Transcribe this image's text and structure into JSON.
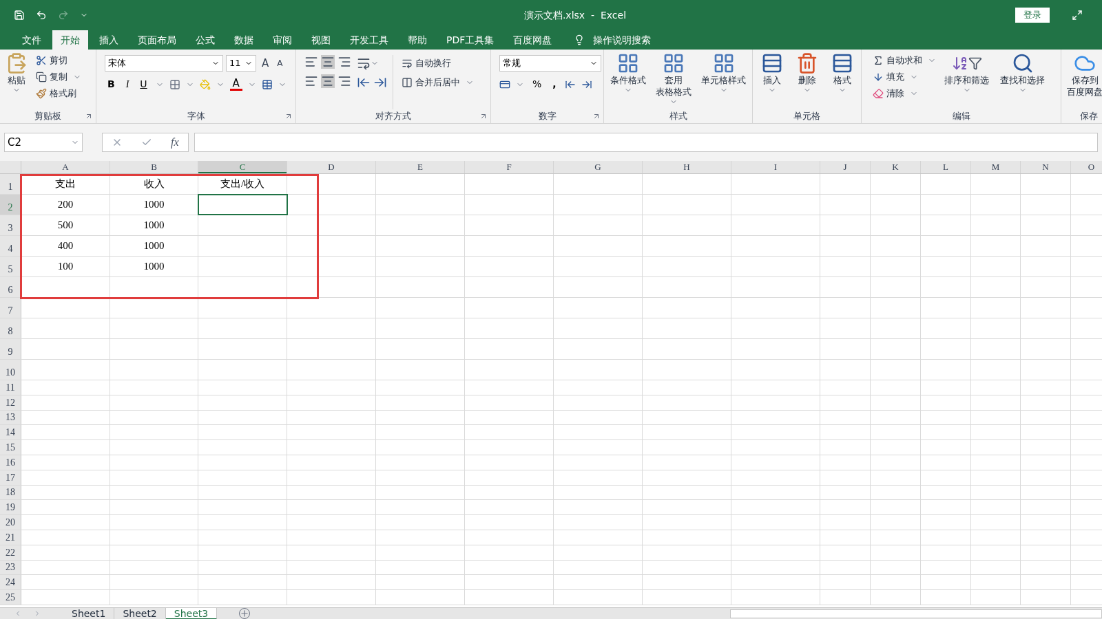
{
  "window": {
    "title": "演示文档.xlsx  -  Excel",
    "login": "登录"
  },
  "menu_tabs": [
    {
      "label": "文件",
      "selected": false
    },
    {
      "label": "开始",
      "selected": true
    },
    {
      "label": "插入",
      "selected": false
    },
    {
      "label": "页面布局",
      "selected": false
    },
    {
      "label": "公式",
      "selected": false
    },
    {
      "label": "数据",
      "selected": false
    },
    {
      "label": "审阅",
      "selected": false
    },
    {
      "label": "视图",
      "selected": false
    },
    {
      "label": "开发工具",
      "selected": false
    },
    {
      "label": "帮助",
      "selected": false
    },
    {
      "label": "PDF工具集",
      "selected": false
    },
    {
      "label": "百度网盘",
      "selected": false
    }
  ],
  "tell_me": "操作说明搜索",
  "ribbon": {
    "clipboard": {
      "paste": "粘贴",
      "cut": "剪切",
      "copy": "复制",
      "format_painter": "格式刷",
      "label": "剪贴板"
    },
    "font": {
      "name": "宋体",
      "size": "11",
      "grow": "A",
      "shrink": "A",
      "bold": "B",
      "italic": "I",
      "underline": "U",
      "color_letter": "A",
      "label": "字体"
    },
    "alignment": {
      "wrap": "自动换行",
      "merge": "合并后居中",
      "label": "对齐方式"
    },
    "number": {
      "format": "常规",
      "percent": "%",
      "comma": ",",
      "label": "数字"
    },
    "styles": {
      "items": [
        {
          "lines": [
            "条件格式"
          ]
        },
        {
          "lines": [
            "套用",
            "表格格式"
          ]
        },
        {
          "lines": [
            "单元格样式"
          ]
        }
      ],
      "label": "样式"
    },
    "cells": {
      "items": [
        {
          "lines": [
            "插入"
          ]
        },
        {
          "lines": [
            "删除"
          ]
        },
        {
          "lines": [
            "格式"
          ]
        }
      ],
      "label": "单元格"
    },
    "editing": {
      "autosum": "自动求和",
      "fill": "填充",
      "clear": "清除",
      "sort": "排序和筛选",
      "find": "查找和选择",
      "label": "编辑"
    },
    "save": {
      "lines": [
        "保存到",
        "百度网盘"
      ],
      "label": "保存"
    }
  },
  "formula_bar": {
    "name_box": "C2",
    "fx": "fx"
  },
  "columns": [
    {
      "label": "A",
      "selected": false
    },
    {
      "label": "B",
      "selected": false
    },
    {
      "label": "C",
      "selected": true
    },
    {
      "label": "D",
      "selected": false
    },
    {
      "label": "E",
      "selected": false
    },
    {
      "label": "F",
      "selected": false
    },
    {
      "label": "G",
      "selected": false
    },
    {
      "label": "H",
      "selected": false
    },
    {
      "label": "I",
      "selected": false
    },
    {
      "label": "J",
      "selected": false
    },
    {
      "label": "K",
      "selected": false
    },
    {
      "label": "L",
      "selected": false
    },
    {
      "label": "M",
      "selected": false
    },
    {
      "label": "N",
      "selected": false
    },
    {
      "label": "O",
      "selected": false
    }
  ],
  "rows": [
    {
      "header": "1",
      "selected": false,
      "cells": [
        {
          "text": "支出",
          "selected": false
        },
        {
          "text": "收入",
          "selected": false
        },
        {
          "text": "支出/收入",
          "selected": false
        }
      ]
    },
    {
      "header": "2",
      "selected": true,
      "cells": [
        {
          "text": "200",
          "selected": false
        },
        {
          "text": "1000",
          "selected": false
        },
        {
          "selected": true
        }
      ]
    },
    {
      "header": "3",
      "selected": false,
      "cells": [
        {
          "text": "500",
          "selected": false
        },
        {
          "text": "1000",
          "selected": false
        }
      ]
    },
    {
      "header": "4",
      "selected": false,
      "cells": [
        {
          "text": "400",
          "selected": false
        },
        {
          "text": "1000",
          "selected": false
        }
      ]
    },
    {
      "header": "5",
      "selected": false,
      "cells": [
        {
          "text": "100",
          "selected": false
        },
        {
          "text": "1000",
          "selected": false
        }
      ]
    },
    {
      "header": "6",
      "selected": false
    },
    {
      "header": "7",
      "selected": false
    },
    {
      "header": "8",
      "selected": false
    },
    {
      "header": "9",
      "selected": false
    },
    {
      "header": "10",
      "selected": false
    },
    {
      "header": "11",
      "selected": false
    },
    {
      "header": "12",
      "selected": false
    },
    {
      "header": "13",
      "selected": false
    },
    {
      "header": "14",
      "selected": false
    },
    {
      "header": "15",
      "selected": false
    },
    {
      "header": "16",
      "selected": false
    },
    {
      "header": "17",
      "selected": false
    },
    {
      "header": "18",
      "selected": false
    },
    {
      "header": "19",
      "selected": false
    },
    {
      "header": "20",
      "selected": false
    },
    {
      "header": "21",
      "selected": false
    },
    {
      "header": "22",
      "selected": false
    },
    {
      "header": "23",
      "selected": false
    },
    {
      "header": "24",
      "selected": false
    },
    {
      "header": "25",
      "selected": false
    }
  ],
  "highlight_box": true,
  "sheets": [
    {
      "label": "Sheet1",
      "selected": false
    },
    {
      "label": "Sheet2",
      "selected": false
    },
    {
      "label": "Sheet3",
      "selected": true
    }
  ]
}
